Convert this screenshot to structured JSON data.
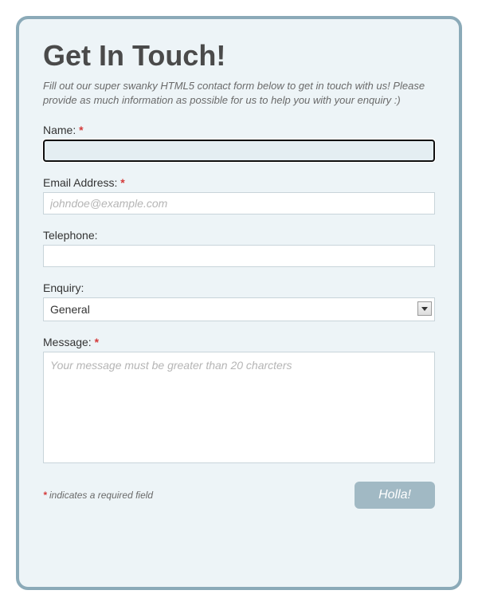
{
  "title": "Get In Touch!",
  "subtitle": "Fill out our super swanky HTML5 contact form below to get in touch with us! Please provide as much information as possible for us to help you with your enquiry :)",
  "fields": {
    "name": {
      "label": "Name:",
      "required": true,
      "value": "",
      "focused": true
    },
    "email": {
      "label": "Email Address:",
      "required": true,
      "placeholder": "johndoe@example.com",
      "value": ""
    },
    "telephone": {
      "label": "Telephone:",
      "required": false,
      "value": ""
    },
    "enquiry": {
      "label": "Enquiry:",
      "required": false,
      "selected": "General"
    },
    "message": {
      "label": "Message:",
      "required": true,
      "placeholder": "Your message must be greater than 20 charcters",
      "value": ""
    }
  },
  "required_marker": "*",
  "required_note": "indicates a required field",
  "submit_label": "Holla!"
}
